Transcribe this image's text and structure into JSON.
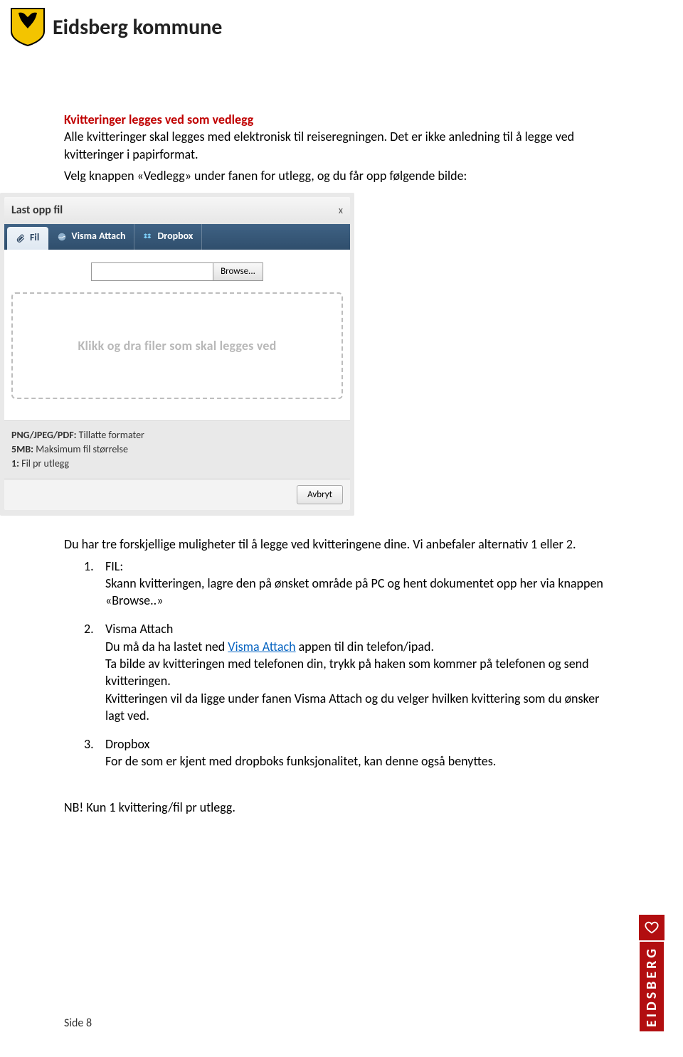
{
  "header": {
    "title": "Eidsberg kommune"
  },
  "section": {
    "title": "Kvitteringer legges ved som vedlegg",
    "para1": "Alle kvitteringer skal legges med elektronisk til reiseregningen. Det er ikke anledning til å legge ved kvitteringer i papirformat.",
    "para2": "Velg knappen «Vedlegg» under fanen for utlegg, og du får opp følgende bilde:"
  },
  "dialog": {
    "title": "Last opp fil",
    "close": "x",
    "tabs": {
      "fil": "Fil",
      "visma": "Visma Attach",
      "dropbox": "Dropbox"
    },
    "browse": "Browse...",
    "dropzone": "Klikk og dra filer som skal legges ved",
    "info": {
      "label_formats": "PNG/JPEG/PDF:",
      "text_formats": " Tillatte formater",
      "label_size": "5MB:",
      "text_size": " Maksimum fil størrelse",
      "label_count": "1:",
      "text_count": " Fil pr utlegg"
    },
    "cancel": "Avbryt"
  },
  "after_dialog": {
    "para": "Du har tre forskjellige muligheter til å legge ved kvitteringene dine. Vi anbefaler alternativ 1 eller 2."
  },
  "list": {
    "n1": "1.",
    "item1_title": "FIL:",
    "item1_body": "Skann kvitteringen, lagre den på ønsket område på PC og hent dokumentet opp her via knappen «Browse..»",
    "n2": "2.",
    "item2_title": "Visma Attach",
    "item2_line1a": "Du må da ha lastet ned ",
    "item2_link": "Visma Attach",
    "item2_line1b": " appen til din telefon/ipad.",
    "item2_line2": "Ta bilde av kvitteringen med telefonen din, trykk på haken som kommer på telefonen og send kvitteringen.",
    "item2_line3": "Kvitteringen vil da ligge under fanen Visma Attach og du velger hvilken kvittering som du ønsker lagt ved.",
    "n3": "3.",
    "item3_title": "Dropbox",
    "item3_body": "For de som er kjent med dropboks funksjonalitet, kan denne også benyttes."
  },
  "nb": "NB! Kun 1 kvittering/fil pr utlegg.",
  "footer": {
    "page": "Side 8"
  },
  "brand": {
    "text": "EIDSBERG"
  }
}
